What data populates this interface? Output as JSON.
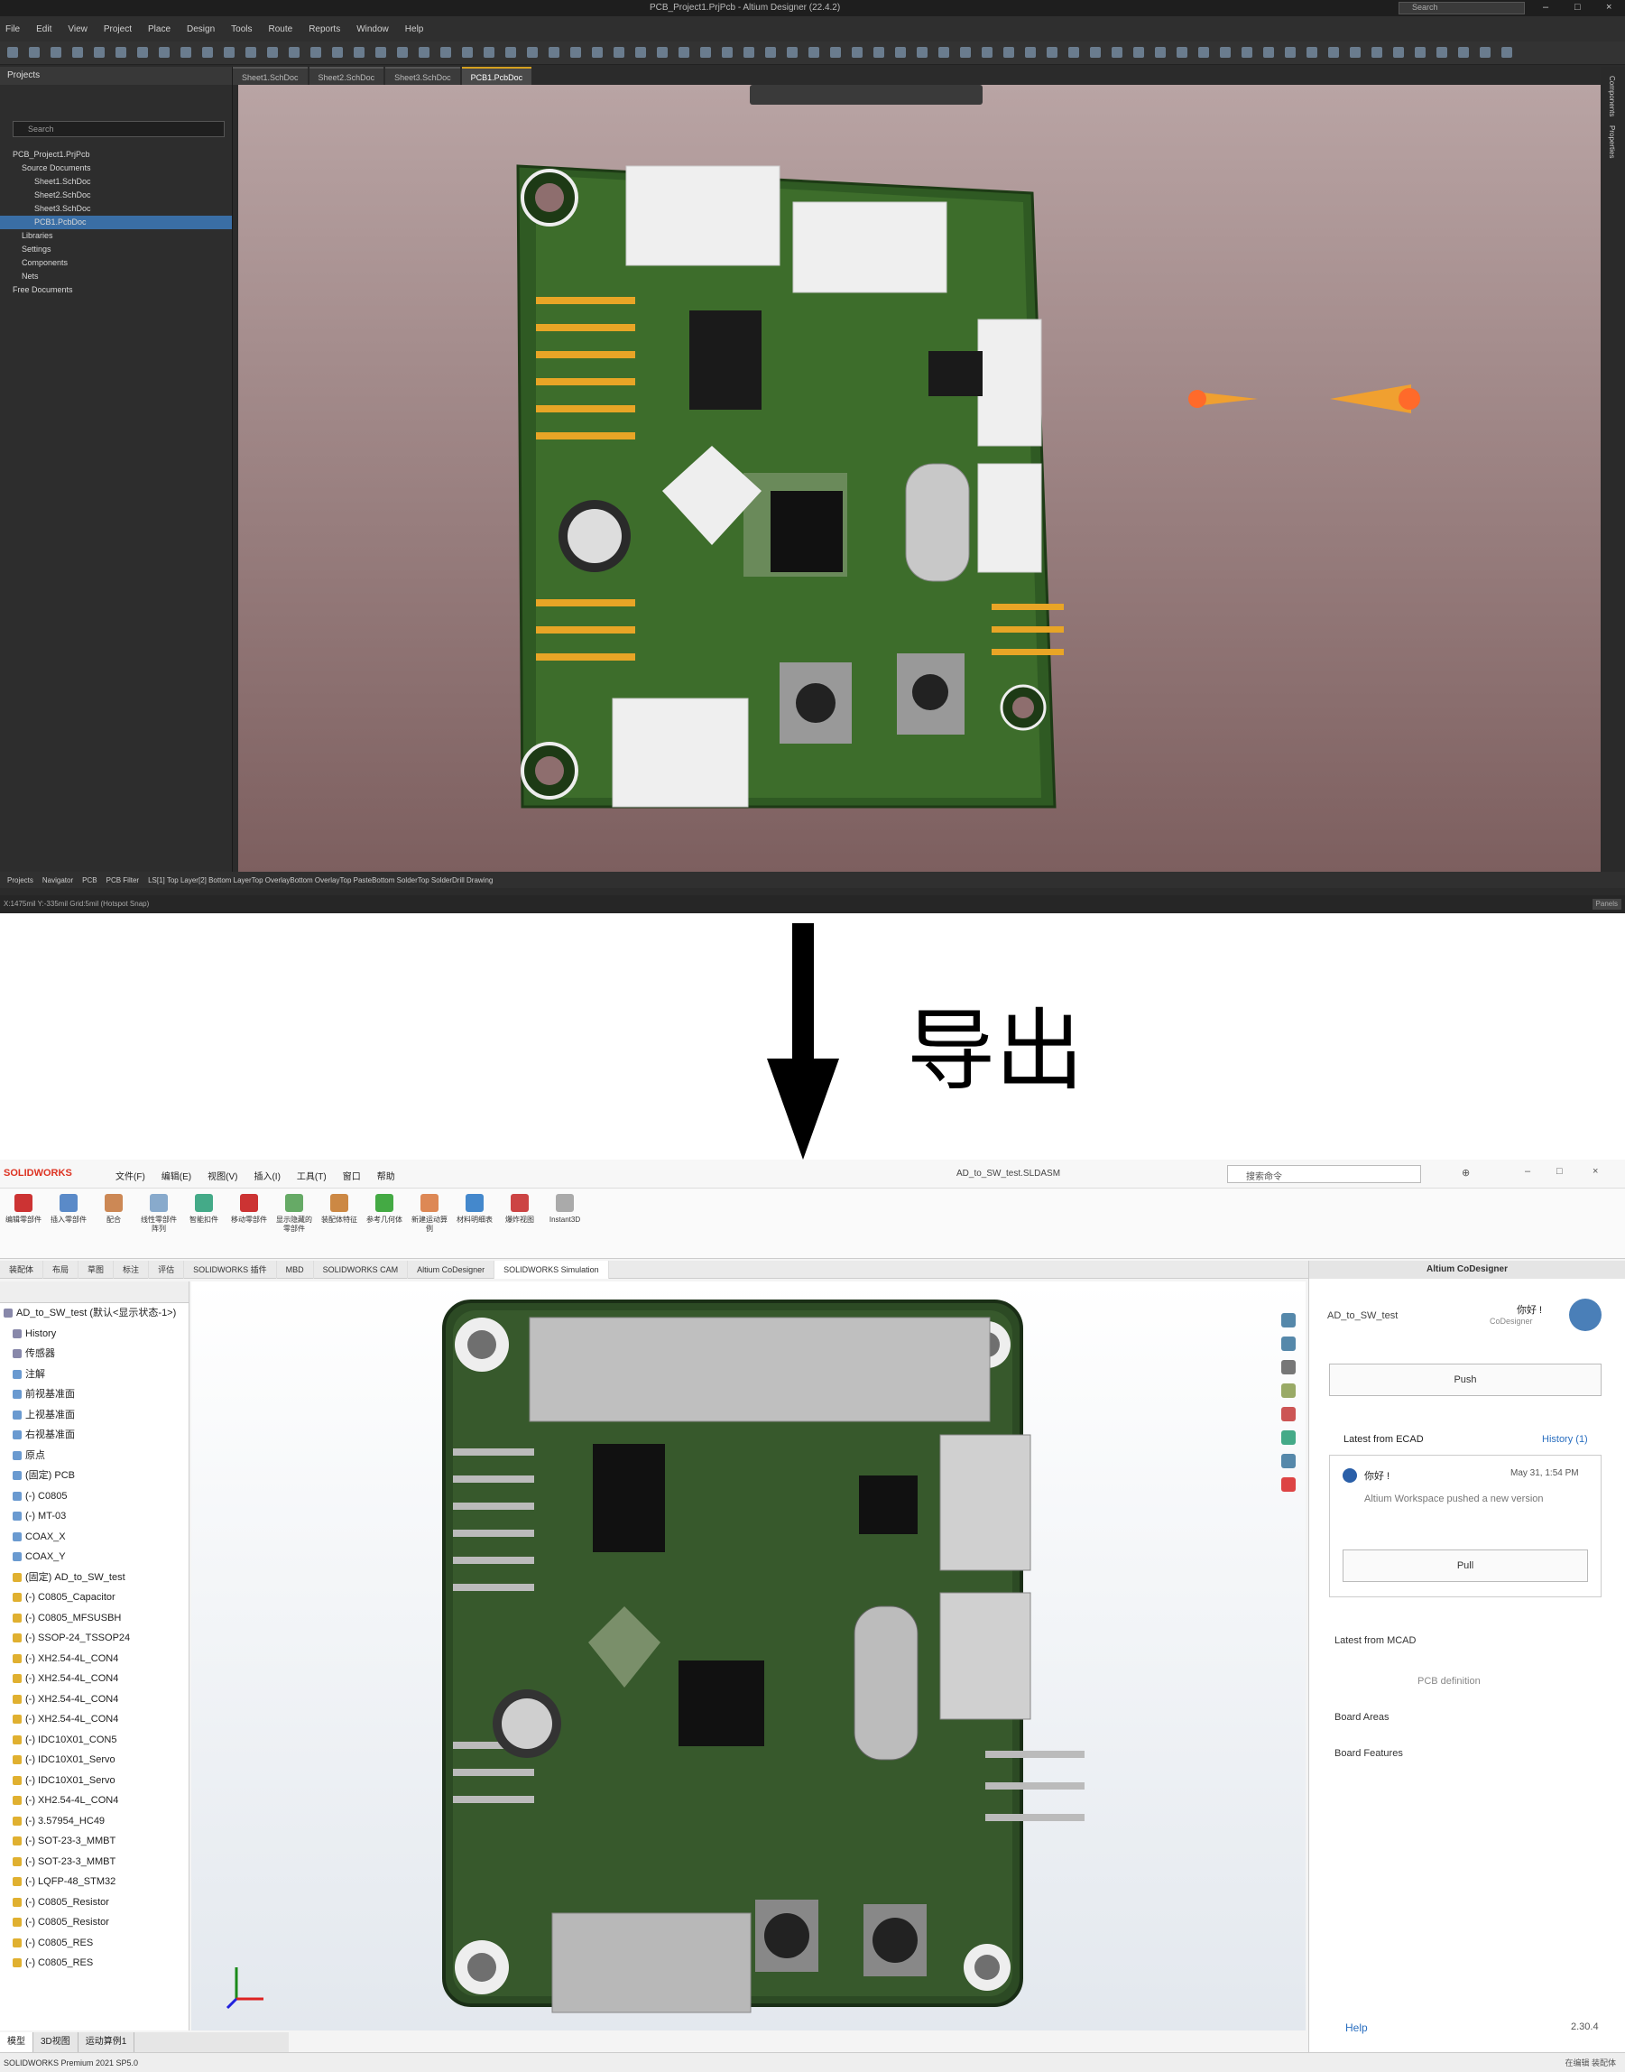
{
  "altium": {
    "title": "PCB_Project1.PrjPcb - Altium Designer (22.4.2)",
    "search": "Search",
    "menu": [
      "File",
      "Edit",
      "View",
      "Project",
      "Place",
      "Design",
      "Tools",
      "Route",
      "Reports",
      "Window",
      "Help"
    ],
    "tabs": [
      "Sheet1.SchDoc",
      "Sheet2.SchDoc",
      "Sheet3.SchDoc",
      "PCB1.PcbDoc"
    ],
    "active_tab": "PCB1.PcbDoc",
    "projects_header": "Projects",
    "search_box": "Search",
    "tree": [
      "PCB_Project1.PrjPcb",
      "Source Documents",
      "Sheet1.SchDoc",
      "Sheet2.SchDoc",
      "Sheet3.SchDoc",
      "PCB1.PcbDoc",
      "Libraries",
      "Settings",
      "Components",
      "Nets",
      "Free Documents"
    ],
    "panel_tabs": [
      "Projects",
      "Navigator",
      "PCB",
      "PCB Filter"
    ],
    "layers": [
      "LS",
      "[1] Top Layer",
      "[2] Bottom Layer",
      "Top Overlay",
      "Bottom Overlay",
      "Top Paste",
      "Bottom Solder",
      "Top Solder",
      "Drill Drawing"
    ],
    "status_left": "X:1475mil Y:-335mil  Grid:5mil  (Hotspot Snap)",
    "status_right": "Panels",
    "right_panels": [
      "Components",
      "Properties"
    ]
  },
  "arrow_label": "导出",
  "solidworks": {
    "logo": "SOLIDWORKS",
    "menu": [
      "文件(F)",
      "编辑(E)",
      "视图(V)",
      "插入(I)",
      "工具(T)",
      "窗口",
      "帮助"
    ],
    "file_title": "AD_to_SW_test.SLDASM",
    "search": "搜索命令",
    "ribbon": [
      "编辑零部件",
      "插入零部件",
      "配合",
      "线性零部件阵列",
      "智能扣件",
      "移动零部件",
      "显示隐藏的零部件",
      "装配体特征",
      "参考几何体",
      "新建运动算例",
      "材料明细表",
      "爆炸视图",
      "Instant3D"
    ],
    "tabs": [
      "装配体",
      "布局",
      "草图",
      "标注",
      "评估",
      "SOLIDWORKS 插件",
      "MBD",
      "SOLIDWORKS CAM",
      "Altium CoDesigner",
      "SOLIDWORKS Simulation"
    ],
    "active_tab": "SOLIDWORKS Simulation",
    "tree": [
      "AD_to_SW_test (默认<显示状态-1>)",
      "History",
      "传感器",
      "注解",
      "前视基准面",
      "上视基准面",
      "右视基准面",
      "原点",
      "(固定) PCB",
      "(-) C0805",
      "(-) MT-03",
      "COAX_X",
      "COAX_Y",
      "(固定) AD_to_SW_test",
      "(-) C0805_Capacitor",
      "(-) C0805_MFSUSBH",
      "(-) SSOP-24_TSSOP24",
      "(-) XH2.54-4L_CON4",
      "(-) XH2.54-4L_CON4",
      "(-) XH2.54-4L_CON4",
      "(-) XH2.54-4L_CON4",
      "(-) IDC10X01_CON5",
      "(-) IDC10X01_Servo",
      "(-) IDC10X01_Servo",
      "(-) XH2.54-4L_CON4",
      "(-) 3.57954_HC49",
      "(-) SOT-23-3_MMBT",
      "(-) SOT-23-3_MMBT",
      "(-) LQFP-48_STM32",
      "(-) C0805_Resistor",
      "(-) C0805_Resistor",
      "(-) C0805_RES",
      "(-) C0805_RES"
    ],
    "bottom_tabs": [
      "模型",
      "3D视图",
      "运动算例1"
    ],
    "panel_title": "Altium CoDesigner",
    "panel_file": "AD_to_SW_test",
    "panel_user": "你好 !",
    "panel_user_sub": "CoDesigner",
    "push_btn": "Push",
    "latest_title": "Latest from ECAD",
    "history": "History (1)",
    "change_user": "你好 !",
    "change_time": "May 31, 1:54 PM",
    "change_desc": "Altium Workspace pushed a new version",
    "pull_btn": "Pull",
    "links": [
      "Latest from MCAD",
      "PCB definition",
      "Board Areas",
      "Board Features"
    ],
    "panel_help": "Help",
    "panel_version": "2.30.4",
    "status": "SOLIDWORKS Premium 2021 SP5.0",
    "status_right": "在编辑 装配体"
  }
}
